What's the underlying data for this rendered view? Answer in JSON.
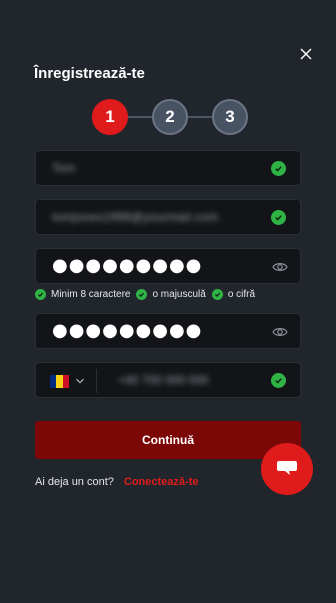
{
  "header": {
    "title": "Înregistrează-te"
  },
  "steps": [
    "1",
    "2",
    "3"
  ],
  "fields": {
    "name": {
      "value": "Tom"
    },
    "email": {
      "value": "tomjones1998@yourmail.com"
    },
    "password": {
      "value": "●●●●●●●●●"
    },
    "password_confirm": {
      "value": "●●●●●●●●●"
    },
    "phone": {
      "value": "+40 700 000 000"
    }
  },
  "password_rules": [
    "Minim 8 caractere",
    "o majusculă",
    "o cifră"
  ],
  "submit_label": "Continuă",
  "login": {
    "question": "Ai deja un cont?",
    "link": "Conectează-te"
  },
  "colors": {
    "accent": "#e01b1b",
    "submit": "#7c0707",
    "success": "#2fb344",
    "background": "#21252c"
  }
}
